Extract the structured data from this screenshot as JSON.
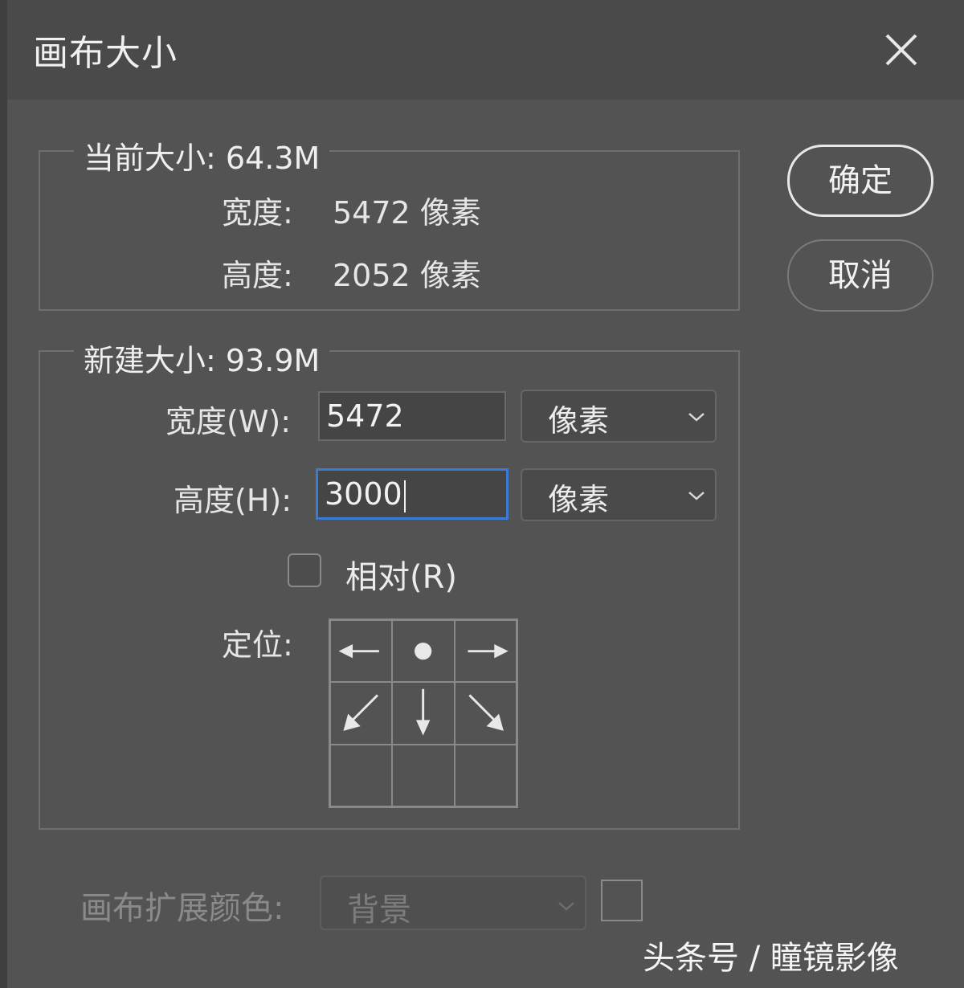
{
  "dialog": {
    "title": "画布大小"
  },
  "current_size": {
    "legend": "当前大小: 64.3M",
    "width_label": "宽度:",
    "width_value": "5472 像素",
    "height_label": "高度:",
    "height_value": "2052 像素"
  },
  "new_size": {
    "legend": "新建大小: 93.9M",
    "width_label": "宽度(W):",
    "width_value": "5472",
    "width_unit": "像素",
    "height_label": "高度(H):",
    "height_value": "3000",
    "height_unit": "像素",
    "relative_label": "相对(R)",
    "relative_checked": false,
    "anchor_label": "定位:",
    "anchor_position": "top-center"
  },
  "buttons": {
    "ok": "确定",
    "cancel": "取消"
  },
  "canvas_extension": {
    "label": "画布扩展颜色:",
    "value": "背景",
    "enabled": false
  },
  "watermark": "头条号 / 瞳镜影像",
  "colors": {
    "dialog_bg": "#535353",
    "titlebar_bg": "#4a4a4a",
    "focus_border": "#3a7bd5",
    "text": "#e6e6e6",
    "disabled_text": "#8a8a8a"
  },
  "icons": {
    "close": "close-icon",
    "dropdown": "chevron-down-icon",
    "anchor_cells": [
      "arrow-left-icon",
      "anchor-dot-icon",
      "arrow-right-icon",
      "arrow-down-left-icon",
      "arrow-down-icon",
      "arrow-down-right-icon",
      "empty",
      "empty",
      "empty"
    ]
  }
}
